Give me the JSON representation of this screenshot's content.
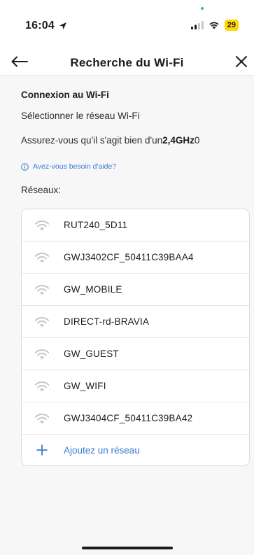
{
  "status_bar": {
    "time": "16:04",
    "battery": "29"
  },
  "header": {
    "title": "Recherche du Wi-Fi"
  },
  "main": {
    "section_heading": "Connexion au Wi-Fi",
    "subtitle": "Sélectionner le réseau Wi-Fi",
    "frequency_prefix": "Assurez-vous qu'il s'agit bien d'un",
    "frequency_value": "2,4GHz",
    "frequency_suffix": "0",
    "help_link": "Avez-vous besoin d'aide?",
    "networks_label": "Réseaux:"
  },
  "networks": [
    {
      "name": "RUT240_5D11"
    },
    {
      "name": "GWJ3402CF_50411C39BAA4"
    },
    {
      "name": "GW_MOBILE"
    },
    {
      "name": "DIRECT-rd-BRAVIA"
    },
    {
      "name": "GW_GUEST"
    },
    {
      "name": "GW_WIFI"
    },
    {
      "name": "GWJ3404CF_50411C39BA42"
    }
  ],
  "add_network": {
    "label": "Ajoutez un réseau"
  },
  "colors": {
    "accent": "#3a7bd5",
    "battery": "#ffd60a",
    "wifi_icon": "#c7c7cc"
  }
}
